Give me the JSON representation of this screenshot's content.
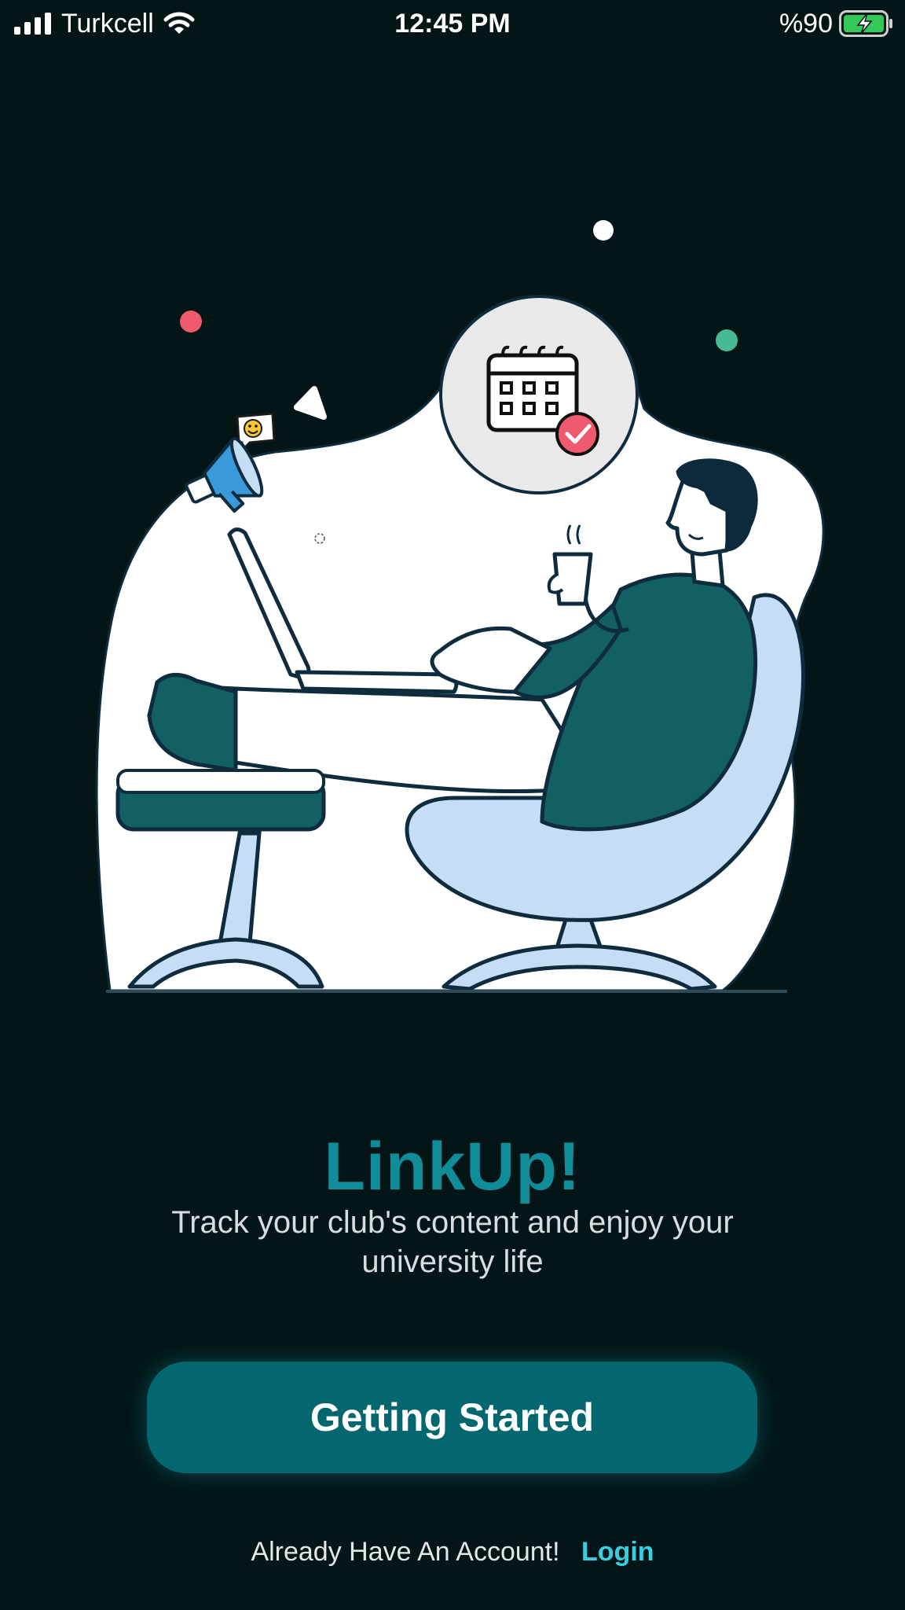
{
  "status_bar": {
    "carrier": "Turkcell",
    "time": "12:45 PM",
    "battery_percent": "%90",
    "icons": [
      "signal-icon",
      "wifi-icon",
      "battery-charging-icon"
    ]
  },
  "illustration": {
    "subject": "man in lounge chair using laptop with coffee",
    "icons": [
      "calendar-check-icon",
      "megaphone-icon",
      "smiley-bubble-icon"
    ]
  },
  "main": {
    "title": "LinkUp!",
    "subtitle": "Track your club's content and enjoy your university life",
    "cta_label": "Getting Started"
  },
  "footer": {
    "prompt": "Already Have An Account!",
    "login_label": "Login"
  },
  "colors": {
    "background": "#031517",
    "title": "#0f8e99",
    "button": "#04676f",
    "link": "#36d0e0",
    "chair": "#c5def5",
    "shirt": "#136064"
  }
}
